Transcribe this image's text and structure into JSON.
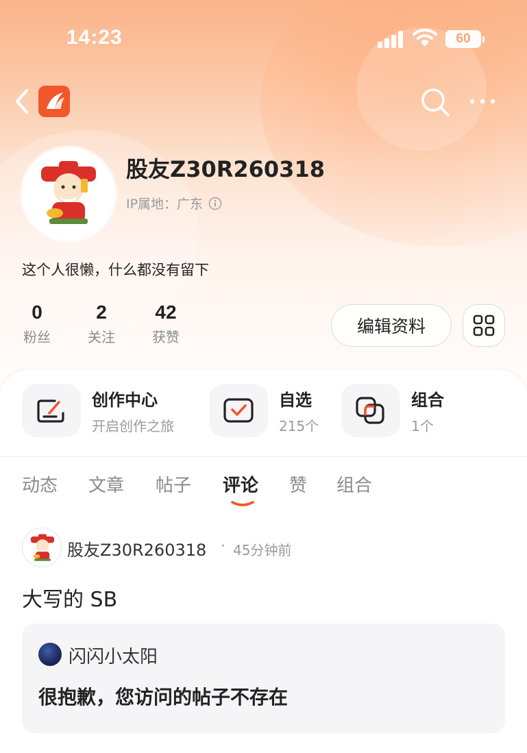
{
  "status_bar": {
    "time": "14:23",
    "battery": "60"
  },
  "header": {
    "back_icon": "chevron-left-icon",
    "logo": "app-logo-icon",
    "search_icon": "search-icon",
    "more_icon": "more-dots-icon"
  },
  "profile": {
    "username": "股友Z30R260318",
    "ip_location": "IP属地：广东",
    "bio": "这个人很懒，什么都没有留下",
    "stats": [
      {
        "value": "0",
        "label": "粉丝"
      },
      {
        "value": "2",
        "label": "关注"
      },
      {
        "value": "42",
        "label": "获赞"
      }
    ],
    "edit_button": "编辑资料"
  },
  "features": [
    {
      "title": "创作中心",
      "subtitle": "开启创作之旅",
      "icon": "create-icon"
    },
    {
      "title": "自选",
      "subtitle": "215个",
      "icon": "watchlist-check-icon"
    },
    {
      "title": "组合",
      "subtitle": "1个",
      "icon": "portfolio-icon"
    }
  ],
  "tabs": [
    "动态",
    "文章",
    "帖子",
    "评论",
    "赞",
    "组合"
  ],
  "active_tab": "评论",
  "comment": {
    "author": "股友Z30R260318",
    "time": "45分钟前",
    "text": "大写的 SB",
    "quote": {
      "author": "闪闪小太阳",
      "text": "很抱歉，您访问的帖子不存在"
    }
  },
  "colors": {
    "accent": "#f2562b",
    "header_gradient_top": "#fbb48a"
  }
}
